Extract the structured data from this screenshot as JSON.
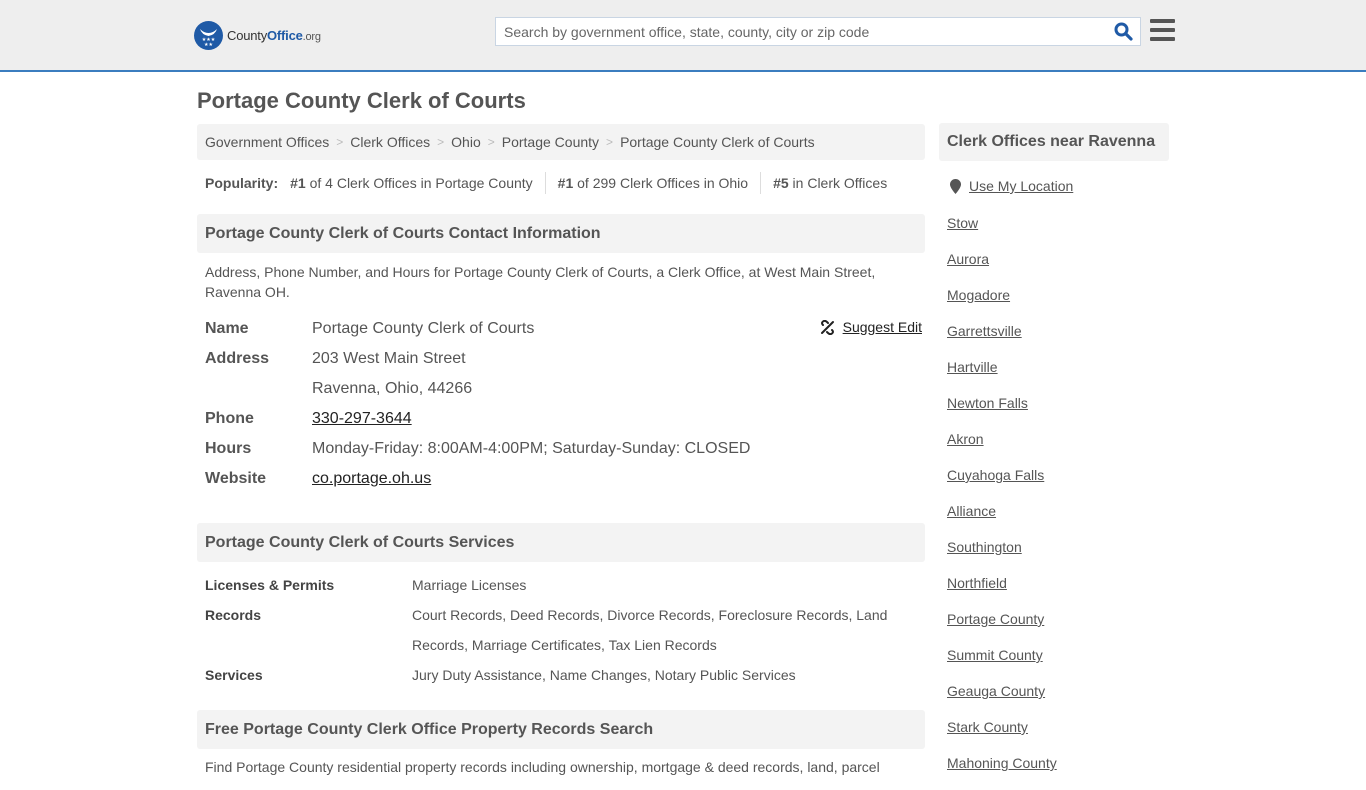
{
  "header": {
    "logo": {
      "county": "County",
      "office": "Office",
      "org": ".org"
    },
    "search_placeholder": "Search by government office, state, county, city or zip code",
    "search_value": "",
    "icons": {
      "search": "search-icon",
      "menu": "hamburger-menu-icon"
    },
    "accent_color": "#1f5aa6",
    "border_color": "#3b7dbf"
  },
  "page_title": "Portage County Clerk of Courts",
  "breadcrumb": [
    "Government Offices",
    "Clerk Offices",
    "Ohio",
    "Portage County",
    "Portage County Clerk of Courts"
  ],
  "popularity": {
    "label": "Popularity:",
    "items": [
      {
        "rank": "#1",
        "text": " of 4 Clerk Offices in Portage County"
      },
      {
        "rank": "#1",
        "text": " of 299 Clerk Offices in Ohio"
      },
      {
        "rank": "#5",
        "text": " in Clerk Offices"
      }
    ]
  },
  "contact": {
    "heading": "Portage County Clerk of Courts Contact Information",
    "description": "Address, Phone Number, and Hours for Portage County Clerk of Courts, a Clerk Office, at West Main Street, Ravenna OH.",
    "suggest_edit": "Suggest Edit",
    "rows": {
      "name": {
        "label": "Name",
        "value": "Portage County Clerk of Courts"
      },
      "address": {
        "label": "Address",
        "line1": "203 West Main Street",
        "line2": "Ravenna, Ohio, 44266"
      },
      "phone": {
        "label": "Phone",
        "value": "330-297-3644"
      },
      "hours": {
        "label": "Hours",
        "value": "Monday-Friday: 8:00AM-4:00PM; Saturday-Sunday: CLOSED"
      },
      "website": {
        "label": "Website",
        "value": "co.portage.oh.us"
      }
    }
  },
  "services": {
    "heading": "Portage County Clerk of Courts Services",
    "rows": [
      {
        "label": "Licenses & Permits",
        "value": "Marriage Licenses"
      },
      {
        "label": "Records",
        "value": "Court Records, Deed Records, Divorce Records, Foreclosure Records, Land Records, Marriage Certificates, Tax Lien Records"
      },
      {
        "label": "Services",
        "value": "Jury Duty Assistance, Name Changes, Notary Public Services"
      }
    ]
  },
  "property": {
    "heading": "Free Portage County Clerk Office Property Records Search",
    "description": "Find Portage County residential property records including ownership, mortgage & deed records, land, parcel"
  },
  "sidebar": {
    "heading": "Clerk Offices near Ravenna",
    "use_location": "Use My Location",
    "nearby": [
      "Stow",
      "Aurora",
      "Mogadore",
      "Garrettsville",
      "Hartville",
      "Newton Falls",
      "Akron",
      "Cuyahoga Falls",
      "Alliance",
      "Southington",
      "Northfield",
      "Portage County",
      "Summit County",
      "Geauga County",
      "Stark County",
      "Mahoning County"
    ]
  }
}
